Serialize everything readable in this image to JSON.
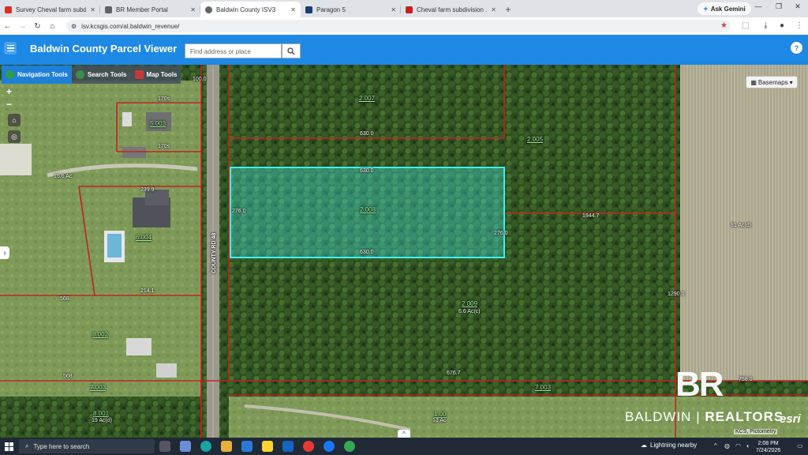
{
  "browser": {
    "tabs": [
      {
        "title": "Survey Cheval farm subdivision",
        "favicon_color": "#d93025",
        "active": false
      },
      {
        "title": "BR Member Portal",
        "favicon_color": "#5f6368",
        "active": false
      },
      {
        "title": "Baldwin County ISV3",
        "favicon_color": "#5f6368",
        "active": true
      },
      {
        "title": "Paragon 5",
        "favicon_color": "#1a3e6e",
        "active": false
      },
      {
        "title": "Cheval farm subdivision .pdf",
        "favicon_color": "#c5221f",
        "active": false
      }
    ],
    "new_tab_label": "+",
    "gemini_label": "Ask Gemini",
    "url": "isv.kcsgis.com/al.baldwin_revenue/"
  },
  "app": {
    "title": "Baldwin County Parcel Viewer",
    "search_placeholder": "Find address or place",
    "help_label": "?",
    "accent_color": "#1e88e5"
  },
  "toolbar": {
    "tools": [
      {
        "label": "Navigation Tools",
        "active": true
      },
      {
        "label": "Search Tools",
        "active": false
      },
      {
        "label": "Map Tools",
        "active": false
      }
    ]
  },
  "map": {
    "zoom_in": "+",
    "zoom_out": "−",
    "basemaps_label": "Basemaps",
    "road_label": "COUNTY RD 48",
    "selected_parcel_color": "#3ff0f0",
    "parcel_line_color": "#c0241f",
    "labels": {
      "parcel_top": "2.007",
      "parcel_right_top": "2.005",
      "parcel_selected": "2.008",
      "parcel_south": "2.009",
      "parcel_south_acres": "6.6 Ac(c)",
      "parcel_east_acres": "81 Ac(d)",
      "parcel_west_acres": "15.6 Ac",
      "parcel_left_mid": "6.004",
      "parcel_left_top": "5.003",
      "parcel_left_low": "8.002",
      "parcel_bottom_left": "7.003",
      "parcel_bottom_mid": "7.003",
      "parcel_bottom_far": "8.001",
      "parcel_bottom_far_acres": "19 Ac(d)",
      "parcel_bottom_center": "1.00",
      "parcel_bottom_center_acres": "13 Ac",
      "dim_sel_top": "630.0",
      "dim_sel_bottom": "630.0",
      "dim_sel_left": "276.0",
      "dim_sel_right": "276.0",
      "dim_top_road": "630.0",
      "dim_east": "1944.7",
      "dim_left_1": "170s",
      "dim_left_2": "170s",
      "dim_left_3": "239.9",
      "dim_left_4": "214.1",
      "dim_left_5": "568",
      "dim_left_6": "568",
      "dim_bottom": "676.7",
      "dim_bottom_right": "758.0",
      "dim_top_1": "100.0",
      "dim_right_line": "1290.0"
    },
    "watermark_brand": "BALDWIN",
    "watermark_brand_bold": "REALTORS",
    "watermark_logo": "BR",
    "esri_label": "esri",
    "credit": "KCS, Pictometry",
    "collapse_label": "^"
  },
  "taskbar": {
    "search_placeholder": "Type here to search",
    "weather": "Lightning nearby",
    "time": "2:08 PM",
    "date": "7/24/2026"
  }
}
